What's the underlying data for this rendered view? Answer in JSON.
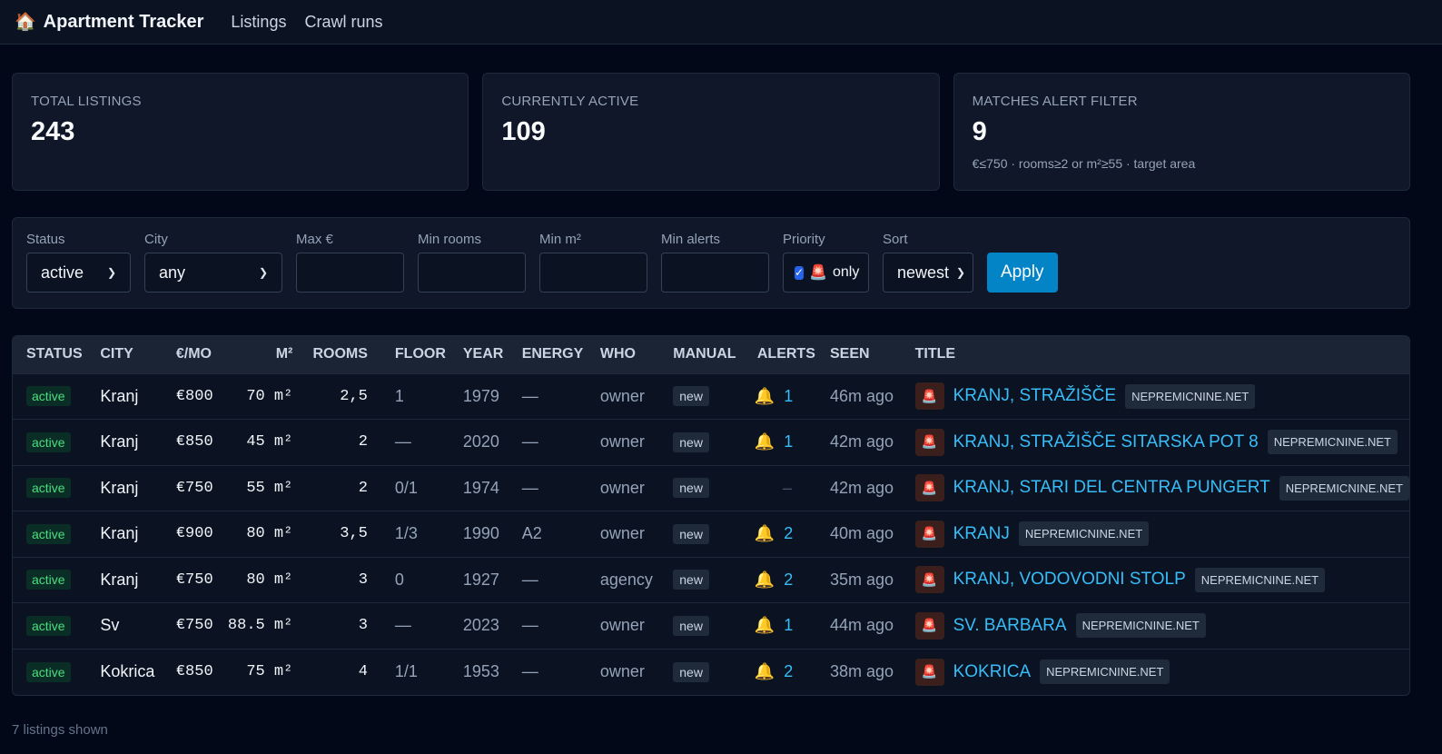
{
  "header": {
    "brand_icon": "🏠",
    "brand": "Apartment Tracker",
    "nav": [
      "Listings",
      "Crawl runs"
    ]
  },
  "stats": [
    {
      "label": "TOTAL LISTINGS",
      "value": "243",
      "sub": ""
    },
    {
      "label": "CURRENTLY ACTIVE",
      "value": "109",
      "sub": ""
    },
    {
      "label": "MATCHES ALERT FILTER",
      "value": "9",
      "sub": "€≤750 · rooms≥2 or m²≥55 · target area"
    }
  ],
  "filters": {
    "status_label": "Status",
    "status_value": "active",
    "city_label": "City",
    "city_value": "any",
    "max_price_label": "Max €",
    "min_rooms_label": "Min rooms",
    "min_m2_label": "Min m²",
    "min_alerts_label": "Min alerts",
    "priority_label": "Priority",
    "priority_icon": "🚨",
    "priority_text": "only",
    "priority_checked": true,
    "sort_label": "Sort",
    "sort_value": "newest",
    "apply_label": "Apply"
  },
  "table": {
    "columns": [
      "STATUS",
      "CITY",
      "€/MO",
      "M²",
      "ROOMS",
      "FLOOR",
      "YEAR",
      "ENERGY",
      "WHO",
      "MANUAL",
      "ALERTS",
      "SEEN",
      "TITLE"
    ],
    "rows": [
      {
        "status": "active",
        "city": "Kranj",
        "price": "€800",
        "m2": "70 m²",
        "rooms": "2,5",
        "floor": "1",
        "year": "1979",
        "energy": "—",
        "who": "owner",
        "manual": "new",
        "alerts": "1",
        "seen": "46m ago",
        "title": "KRANJ, STRAŽIŠČE",
        "source": "NEPREMICNINE.NET"
      },
      {
        "status": "active",
        "city": "Kranj",
        "price": "€850",
        "m2": "45 m²",
        "rooms": "2",
        "floor": "—",
        "year": "2020",
        "energy": "—",
        "who": "owner",
        "manual": "new",
        "alerts": "1",
        "seen": "42m ago",
        "title": "KRANJ, STRAŽIŠČE SITARSKA POT 8",
        "source": "NEPREMICNINE.NET"
      },
      {
        "status": "active",
        "city": "Kranj",
        "price": "€750",
        "m2": "55 m²",
        "rooms": "2",
        "floor": "0/1",
        "year": "1974",
        "energy": "—",
        "who": "owner",
        "manual": "new",
        "alerts": "",
        "seen": "42m ago",
        "title": "KRANJ, STARI DEL CENTRA PUNGERT",
        "source": "NEPREMICNINE.NET"
      },
      {
        "status": "active",
        "city": "Kranj",
        "price": "€900",
        "m2": "80 m²",
        "rooms": "3,5",
        "floor": "1/3",
        "year": "1990",
        "energy": "A2",
        "who": "owner",
        "manual": "new",
        "alerts": "2",
        "seen": "40m ago",
        "title": "KRANJ",
        "source": "NEPREMICNINE.NET"
      },
      {
        "status": "active",
        "city": "Kranj",
        "price": "€750",
        "m2": "80 m²",
        "rooms": "3",
        "floor": "0",
        "year": "1927",
        "energy": "—",
        "who": "agency",
        "manual": "new",
        "alerts": "2",
        "seen": "35m ago",
        "title": "KRANJ, VODOVODNI STOLP",
        "source": "NEPREMICNINE.NET"
      },
      {
        "status": "active",
        "city": "Sv",
        "price": "€750",
        "m2": "88.5 m²",
        "rooms": "3",
        "floor": "—",
        "year": "2023",
        "energy": "—",
        "who": "owner",
        "manual": "new",
        "alerts": "1",
        "seen": "44m ago",
        "title": "SV. BARBARA",
        "source": "NEPREMICNINE.NET"
      },
      {
        "status": "active",
        "city": "Kokrica",
        "price": "€850",
        "m2": "75 m²",
        "rooms": "4",
        "floor": "1/1",
        "year": "1953",
        "energy": "—",
        "who": "owner",
        "manual": "new",
        "alerts": "2",
        "seen": "38m ago",
        "title": "KOKRICA",
        "source": "NEPREMICNINE.NET"
      }
    ],
    "no_alerts_text": "–",
    "bell_icon": "🔔",
    "siren_icon": "🚨"
  },
  "footer": "7 listings shown"
}
